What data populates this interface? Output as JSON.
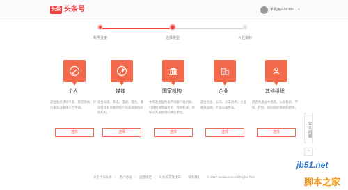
{
  "header": {
    "logo_badge": "头条",
    "logo_text": "头条号",
    "user_name": "手机用户56386...",
    "caret": "▾"
  },
  "steps": [
    {
      "label": "账号注册",
      "state": "done"
    },
    {
      "label": "选择类型",
      "state": "active"
    },
    {
      "label": "入驻资料",
      "state": "todo"
    }
  ],
  "cards": [
    {
      "title": "个人",
      "icon": "pencil-icon",
      "desc": "适合垂直领域专家、意见领袖、评论家及自媒体人士申请。",
      "button": "选择"
    },
    {
      "title": "媒体",
      "icon": "microphone-icon",
      "desc": "适合报纸、杂志、电视、电台、通讯社等具有新闻生产内容资质的组织机构。",
      "button": "选择"
    },
    {
      "title": "国家机构",
      "icon": "government-building-icon",
      "desc": "中央及全国各省市地级行政机关、行政机关直属机构、党群机关，参照公务员管理的事业单位。",
      "button": "选择"
    },
    {
      "title": "企业",
      "icon": "office-building-icon",
      "desc": "适合企业、公司、分支机构、企业相关品牌、产品与服务等。",
      "button": "选择"
    },
    {
      "title": "其他组织",
      "icon": "people-group-icon",
      "desc": "适合各类公共场馆、公益机构、学校、社团、民间组织等机构团体。",
      "button": "选择"
    }
  ],
  "side": {
    "help": "常见问题",
    "top": "^"
  },
  "footer": {
    "links": [
      "关于今日头条",
      "用户协议",
      "运营规范",
      "头条号开放接口",
      "联系我们"
    ],
    "copyright": "© 2017 toutiao.com All Rights Res"
  },
  "watermark": {
    "line1": "jb51.net",
    "line2": "脚本之家"
  },
  "colors": {
    "accent": "#f04142",
    "card_icon": "#f26a4b"
  }
}
